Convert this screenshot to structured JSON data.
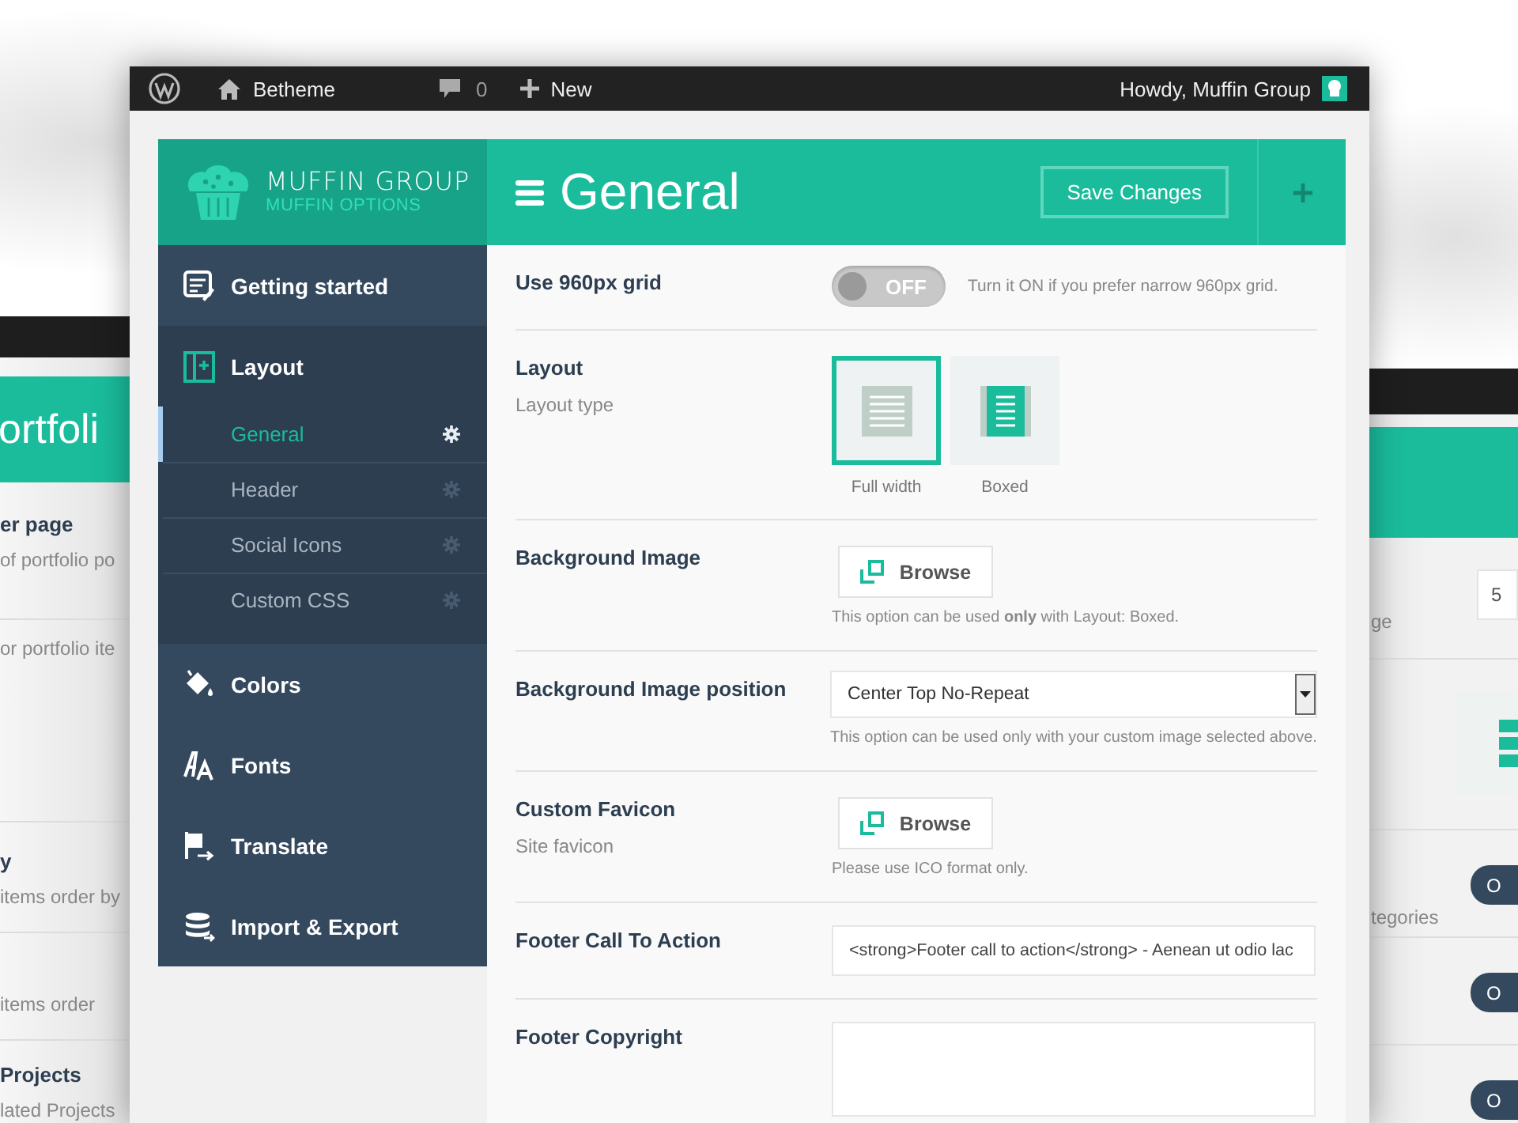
{
  "desktop_window_left": {
    "title": "ortfoli",
    "rows": [
      {
        "label": "er page",
        "description": "of portfolio po"
      },
      {
        "description": "or portfolio ite"
      },
      {
        "label": "y",
        "description": "items order by"
      },
      {
        "description": "items order"
      },
      {
        "label": "Projects",
        "description": "lated Projects"
      }
    ]
  },
  "desktop_window_right": {
    "rows": [
      {
        "kind": "field",
        "description": "ge",
        "value": "5"
      },
      {
        "kind": "image"
      },
      {
        "kind": "switch",
        "description": "tegories",
        "state_label": "O",
        "on": false
      },
      {
        "kind": "switch",
        "state_label": "O",
        "on": false
      },
      {
        "kind": "switch",
        "state_label": "O",
        "on": false
      }
    ]
  },
  "admin_bar": {
    "site": "Betheme",
    "comments": "0",
    "new": "New",
    "greeting": "Howdy, Muffin Group"
  },
  "header": {
    "brand": "MUFFIN GROUP",
    "subtitle": "MUFFIN OPTIONS",
    "title": "General",
    "save_button": "Save Changes"
  },
  "sidebar": {
    "items": [
      {
        "label": "Getting started",
        "kind": "edit",
        "expanded": false
      },
      {
        "label": "Layout",
        "kind": "layout",
        "expanded": true,
        "children": [
          {
            "label": "General",
            "selected": true
          },
          {
            "label": "Header",
            "selected": false
          },
          {
            "label": "Social Icons",
            "selected": false
          },
          {
            "label": "Custom CSS",
            "selected": false
          }
        ]
      },
      {
        "label": "Colors",
        "kind": "bucket",
        "expanded": false
      },
      {
        "label": "Fonts",
        "kind": "fonts",
        "expanded": false
      },
      {
        "label": "Translate",
        "kind": "flag",
        "expanded": false
      },
      {
        "label": "Import & Export",
        "kind": "database",
        "expanded": false
      }
    ]
  },
  "options": [
    {
      "kind": "switch",
      "label": "Use 960px grid",
      "on": false,
      "state_label": "OFF",
      "hint": "Turn it ON if you prefer narrow 960px grid."
    },
    {
      "kind": "layout",
      "label": "Layout",
      "description": "Layout type",
      "choices": [
        {
          "label": "Full width",
          "kind": "full",
          "selected": true
        },
        {
          "label": "Boxed",
          "kind": "boxed",
          "selected": false
        }
      ]
    },
    {
      "kind": "upload",
      "label": "Background Image",
      "button": "Browse",
      "note": "This option can be used **only** with Layout: Boxed."
    },
    {
      "kind": "select",
      "label": "Background Image position",
      "value": "Center Top No-Repeat",
      "note": "This option can be used only with your custom image selected above."
    },
    {
      "kind": "upload",
      "label": "Custom Favicon",
      "description": "Site favicon",
      "button": "Browse",
      "note": "Please use ICO format only."
    },
    {
      "kind": "text",
      "label": "Footer Call To Action",
      "value": "<strong>Footer call to action</strong> - Aenean ut odio lac"
    },
    {
      "kind": "textarea",
      "label": "Footer Copyright"
    }
  ]
}
